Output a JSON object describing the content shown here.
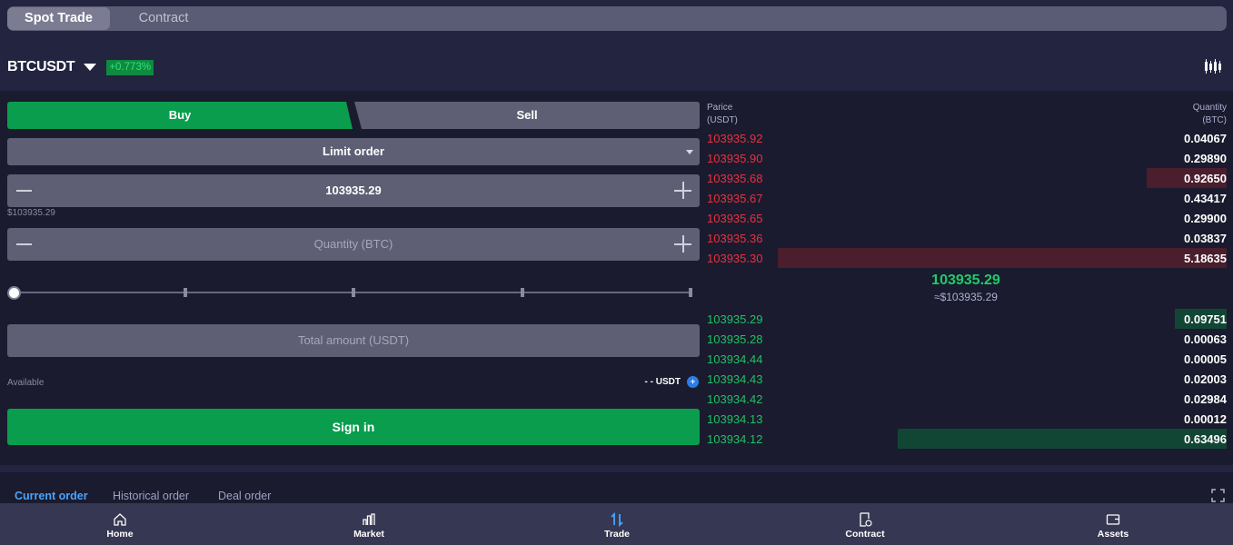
{
  "top_tabs": {
    "spot": "Spot Trade",
    "contract": "Contract"
  },
  "pair": {
    "symbol": "BTCUSDT",
    "change": "+0.773%"
  },
  "form": {
    "buy_label": "Buy",
    "sell_label": "Sell",
    "order_type": "Limit order",
    "price_value": "103935.29",
    "price_usd": "$103935.29",
    "quantity_placeholder": "Quantity (BTC)",
    "total_placeholder": "Total amount (USDT)",
    "available_label": "Available",
    "available_value": "- - USDT",
    "signin_label": "Sign in"
  },
  "orderbook": {
    "price_header": "Parice",
    "price_unit": "(USDT)",
    "qty_header": "Quantity",
    "qty_unit": "(BTC)",
    "asks": [
      {
        "price": "103935.92",
        "qty": "0.04067",
        "depth": 0.0
      },
      {
        "price": "103935.90",
        "qty": "0.29890",
        "depth": 0.0
      },
      {
        "price": "103935.68",
        "qty": "0.92650",
        "depth": 0.153
      },
      {
        "price": "103935.67",
        "qty": "0.43417",
        "depth": 0.0
      },
      {
        "price": "103935.65",
        "qty": "0.29900",
        "depth": 0.0
      },
      {
        "price": "103935.36",
        "qty": "0.03837",
        "depth": 0.0
      },
      {
        "price": "103935.30",
        "qty": "5.18635",
        "depth": 0.861
      }
    ],
    "mid_price": "103935.29",
    "mid_usd": "≈$103935.29",
    "bids": [
      {
        "price": "103935.29",
        "qty": "0.09751",
        "depth": 0.099
      },
      {
        "price": "103935.28",
        "qty": "0.00063",
        "depth": 0.0
      },
      {
        "price": "103934.44",
        "qty": "0.00005",
        "depth": 0.0
      },
      {
        "price": "103934.43",
        "qty": "0.02003",
        "depth": 0.0
      },
      {
        "price": "103934.42",
        "qty": "0.02984",
        "depth": 0.0
      },
      {
        "price": "103934.13",
        "qty": "0.00012",
        "depth": 0.0
      },
      {
        "price": "103934.12",
        "qty": "0.63496",
        "depth": 0.631
      }
    ]
  },
  "order_tabs": {
    "current": "Current order",
    "historical": "Historical order",
    "deal": "Deal order"
  },
  "nav": {
    "home": "Home",
    "market": "Market",
    "trade": "Trade",
    "contract": "Contract",
    "assets": "Assets"
  },
  "colors": {
    "buy": "#0a9d4d",
    "ask": "#e8313f",
    "bid": "#20c063",
    "accent": "#4aa3ff"
  }
}
